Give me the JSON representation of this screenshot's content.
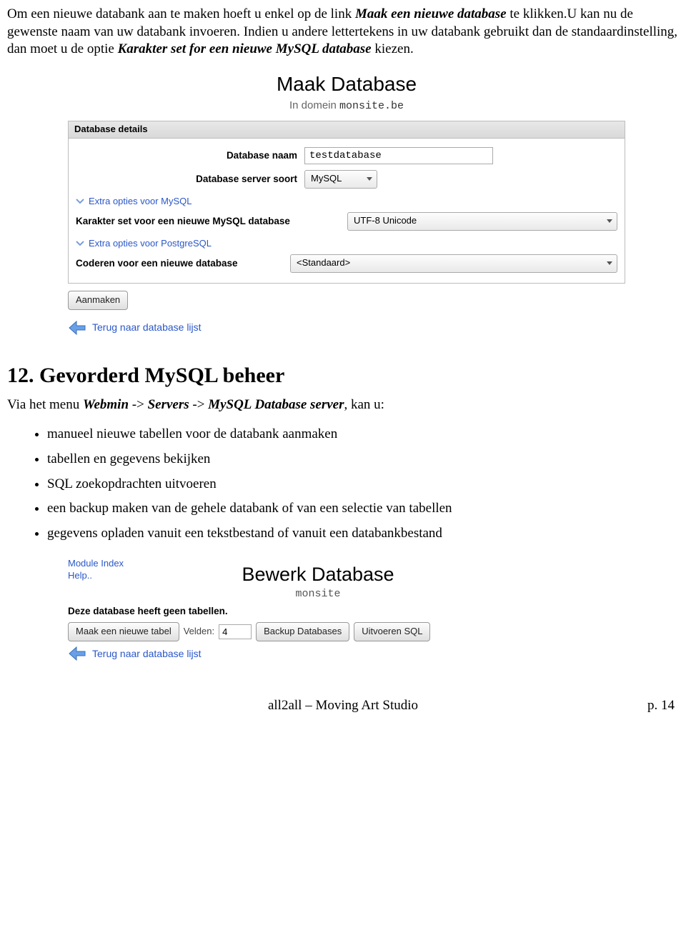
{
  "intro_paragraph": {
    "t1": "Om een nieuwe databank aan te maken hoeft u enkel op de link ",
    "b1": "Maak een nieuwe database",
    "t2": " te klikken.U kan nu de gewenste naam van uw databank invoeren. Indien u andere lettertekens in uw databank gebruikt dan de standaardinstelling, dan moet u de optie ",
    "b2": "Karakter set for een nieuwe MySQL database",
    "t3": " kiezen."
  },
  "screenshot1": {
    "title": "Maak Database",
    "sub_prefix": "In domein ",
    "sub_domain": "monsite.be",
    "panel_header": "Database details",
    "db_name_label": "Database naam",
    "db_name_value": "testdatabase",
    "db_server_label": "Database server soort",
    "db_server_value": "MySQL",
    "exp_mysql": "Extra opties voor MySQL",
    "charset_label": "Karakter set voor een nieuwe MySQL database",
    "charset_value": "UTF-8 Unicode",
    "exp_pg": "Extra opties voor PostgreSQL",
    "encode_label": "Coderen voor een nieuwe database",
    "encode_value": "<Standaard>",
    "create_btn": "Aanmaken",
    "back_link": "Terug naar database lijst"
  },
  "section_heading": "12. Gevorderd MySQL beheer",
  "section_intro": {
    "t1": "Via het menu ",
    "b1": "Webmin",
    "t2": " -> ",
    "b2": "Servers",
    "t3": " -> ",
    "b3": "MySQL Database server",
    "t4": ", kan u:"
  },
  "bullets": [
    "manueel nieuwe tabellen voor de databank aanmaken",
    "tabellen en gegevens bekijken",
    "SQL zoekopdrachten uitvoeren",
    "een backup maken van de gehele databank of van een selectie van tabellen",
    " gegevens opladen vanuit een tekstbestand of vanuit een databankbestand"
  ],
  "screenshot2": {
    "link1": "Module Index",
    "link2": "Help..",
    "title": "Bewerk Database",
    "sub": "monsite",
    "msg": "Deze database heeft geen tabellen.",
    "btn_newtable": "Maak een nieuwe tabel",
    "fields_label": "Velden:",
    "fields_value": "4",
    "btn_backup": "Backup Databases",
    "btn_sql": "Uitvoeren SQL",
    "back_link": "Terug naar database lijst"
  },
  "footer_center": "all2all – Moving Art Studio",
  "footer_page": "p. 14"
}
